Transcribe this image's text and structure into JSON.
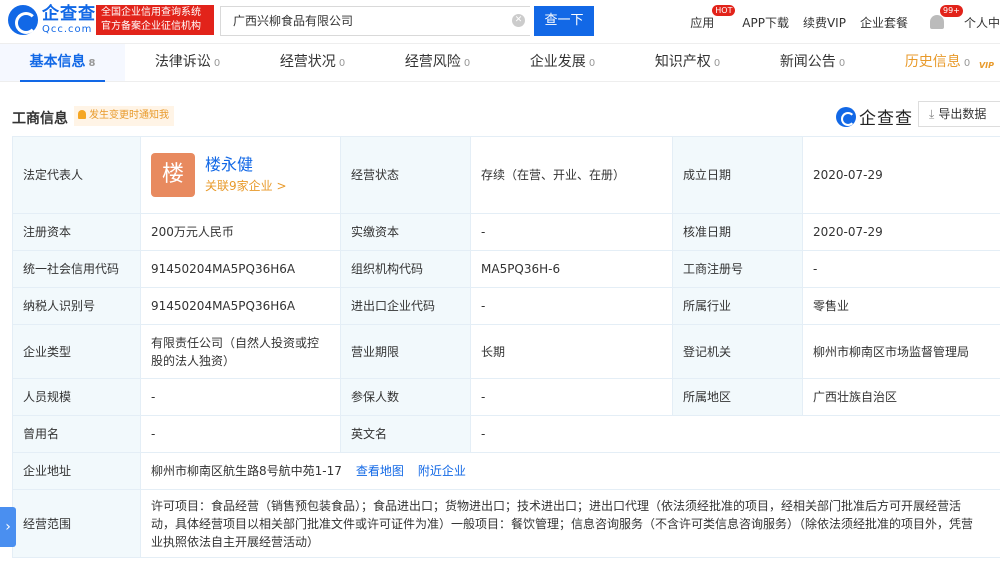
{
  "header": {
    "logo_cn": "企查查",
    "logo_en": "Qcc.com",
    "badge_line1": "全国企业信用查询系统",
    "badge_line2": "官方备案企业征信机构",
    "search_value": "广西兴柳食品有限公司",
    "search_button": "查一下",
    "nav": {
      "apps": "应用",
      "hot": "HOT",
      "app_download": "APP下载",
      "renew_vip": "续费VIP",
      "enterprise_package": "企业套餐",
      "notifications": "99+",
      "personal": "个人中"
    }
  },
  "tabs": [
    {
      "label": "基本信息",
      "count": "8"
    },
    {
      "label": "法律诉讼",
      "count": "0"
    },
    {
      "label": "经营状况",
      "count": "0"
    },
    {
      "label": "经营风险",
      "count": "0"
    },
    {
      "label": "企业发展",
      "count": "0"
    },
    {
      "label": "知识产权",
      "count": "0"
    },
    {
      "label": "新闻公告",
      "count": "0"
    },
    {
      "label": "历史信息",
      "count": "0",
      "vip": "VIP"
    }
  ],
  "section": {
    "title": "工商信息",
    "notice": "发生变更时通知我",
    "watermark": "企查查",
    "export": "导出数据"
  },
  "info": {
    "legal_rep_label": "法定代表人",
    "legal_rep_avatar": "楼",
    "legal_rep_name": "楼永健",
    "legal_rep_link": "关联9家企业 >",
    "status_label": "经营状态",
    "status_value": "存续（在营、开业、在册）",
    "founded_label": "成立日期",
    "founded_value": "2020-07-29",
    "reg_capital_label": "注册资本",
    "reg_capital_value": "200万元人民币",
    "paid_capital_label": "实缴资本",
    "paid_capital_value": "-",
    "approval_date_label": "核准日期",
    "approval_date_value": "2020-07-29",
    "credit_code_label": "统一社会信用代码",
    "credit_code_value": "91450204MA5PQ36H6A",
    "org_code_label": "组织机构代码",
    "org_code_value": "MA5PQ36H-6",
    "biz_reg_no_label": "工商注册号",
    "biz_reg_no_value": "-",
    "taxpayer_id_label": "纳税人识别号",
    "taxpayer_id_value": "91450204MA5PQ36H6A",
    "import_export_label": "进出口企业代码",
    "import_export_value": "-",
    "industry_label": "所属行业",
    "industry_value": "零售业",
    "company_type_label": "企业类型",
    "company_type_value": "有限责任公司（自然人投资或控股的法人独资）",
    "term_label": "营业期限",
    "term_value": "长期",
    "authority_label": "登记机关",
    "authority_value": "柳州市柳南区市场监督管理局",
    "staff_size_label": "人员规模",
    "staff_size_value": "-",
    "insured_label": "参保人数",
    "insured_value": "-",
    "region_label": "所属地区",
    "region_value": "广西壮族自治区",
    "former_name_label": "曾用名",
    "former_name_value": "-",
    "english_name_label": "英文名",
    "english_name_value": "-",
    "address_label": "企业地址",
    "address_value": "柳州市柳南区航生路8号航中苑1-17",
    "view_map": "查看地图",
    "nearby": "附近企业",
    "scope_label": "经营范围",
    "scope_value": "许可项目：食品经营（销售预包装食品）；食品进出口；货物进出口；技术进出口；进出口代理（依法须经批准的项目，经相关部门批准后方可开展经营活动，具体经营项目以相关部门批准文件或许可证件为准）一般项目：餐饮管理；信息咨询服务（不含许可类信息咨询服务）（除依法须经批准的项目外，凭营业执照依法自主开展经营活动）"
  }
}
